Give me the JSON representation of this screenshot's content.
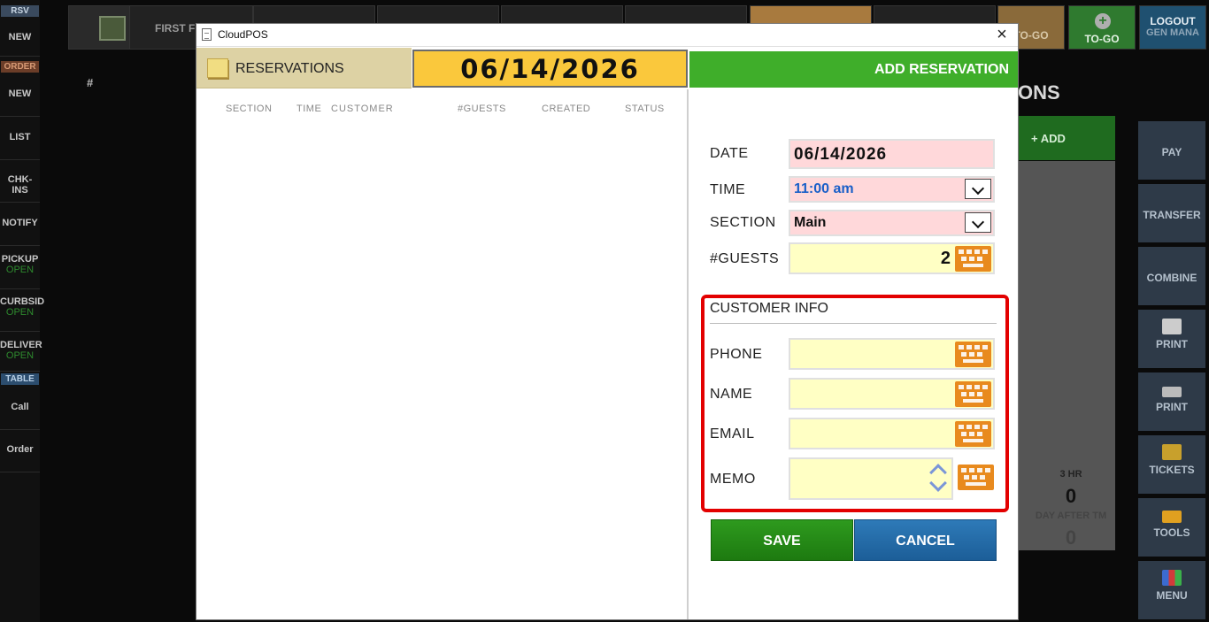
{
  "window": {
    "title": "CloudPOS"
  },
  "leftnav": {
    "rsv_tag": "RSV",
    "order_tag": "ORDER",
    "table_tag": "TABLE",
    "items": [
      {
        "label": "NEW"
      },
      {
        "label": "NEW"
      },
      {
        "label": "LIST"
      },
      {
        "label": "CHK-INS"
      },
      {
        "label": "NOTIFY"
      },
      {
        "label": "PICKUP",
        "sub": "OPEN"
      },
      {
        "label": "CURBSID",
        "sub": "OPEN"
      },
      {
        "label": "DELIVER",
        "sub": "OPEN"
      },
      {
        "label": "Call"
      },
      {
        "label": "Order"
      }
    ]
  },
  "background": {
    "hash": "#",
    "first_button": "FIRST F",
    "togo_left": "TO-GO",
    "togo_right": "TO-GO",
    "togo_plus": "+",
    "logout": "LOGOUT",
    "logout_user": "GEN MANA",
    "title_fragment": "ONS",
    "add": "+ ADD",
    "stats": {
      "label1": "3 HR",
      "value1": "0",
      "label2": "DAY AFTER TM",
      "value2": "0"
    },
    "right_buttons": [
      "PAY",
      "TRANSFER",
      "COMBINE",
      "PRINT",
      "PRINT",
      "TICKETS",
      "TOOLS",
      "MENU"
    ]
  },
  "modal": {
    "header_title": "RESERVATIONS",
    "header_date": "06/14/2026",
    "add_reservation": "ADD RESERVATION",
    "columns": [
      "SECTION",
      "TIME",
      "CUSTOMER",
      "#GUESTS",
      "CREATED",
      "STATUS"
    ],
    "form": {
      "date_label": "DATE",
      "date_value": "06/14/2026",
      "time_label": "TIME",
      "time_value": "11:00 am",
      "section_label": "SECTION",
      "section_value": "Main",
      "guests_label": "#GUESTS",
      "guests_value": "2",
      "customer_info_title": "CUSTOMER INFO",
      "phone_label": "PHONE",
      "name_label": "NAME",
      "email_label": "EMAIL",
      "memo_label": "MEMO",
      "phone_value": "",
      "name_value": "",
      "email_value": "",
      "memo_value": "",
      "save": "SAVE",
      "cancel": "CANCEL"
    }
  }
}
